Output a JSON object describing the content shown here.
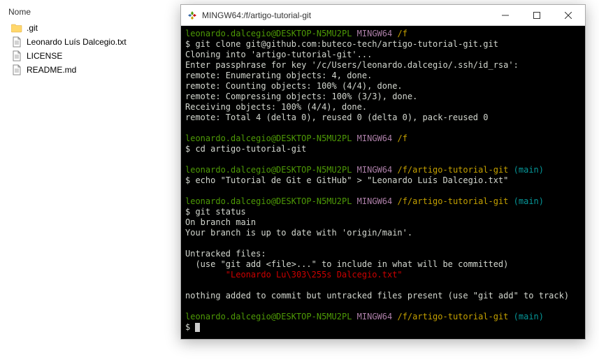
{
  "explorer": {
    "header": "Nome",
    "items": [
      {
        "name": ".git",
        "type": "folder"
      },
      {
        "name": "Leonardo Luís Dalcegio.txt",
        "type": "file"
      },
      {
        "name": "LICENSE",
        "type": "file"
      },
      {
        "name": "README.md",
        "type": "file"
      }
    ]
  },
  "terminal": {
    "title": "MINGW64:/f/artigo-tutorial-git",
    "prompts": [
      {
        "user": "leonardo.dalcegio@DESKTOP-N5MU2PL",
        "env": "MINGW64",
        "path": "/f",
        "branch": ""
      },
      {
        "user": "leonardo.dalcegio@DESKTOP-N5MU2PL",
        "env": "MINGW64",
        "path": "/f",
        "branch": ""
      },
      {
        "user": "leonardo.dalcegio@DESKTOP-N5MU2PL",
        "env": "MINGW64",
        "path": "/f/artigo-tutorial-git",
        "branch": "(main)"
      },
      {
        "user": "leonardo.dalcegio@DESKTOP-N5MU2PL",
        "env": "MINGW64",
        "path": "/f/artigo-tutorial-git",
        "branch": "(main)"
      },
      {
        "user": "leonardo.dalcegio@DESKTOP-N5MU2PL",
        "env": "MINGW64",
        "path": "/f/artigo-tutorial-git",
        "branch": "(main)"
      }
    ],
    "cmd1": "$ git clone git@github.com:buteco-tech/artigo-tutorial-git.git",
    "out1a": "Cloning into 'artigo-tutorial-git'...",
    "out1b": "Enter passphrase for key '/c/Users/leonardo.dalcegio/.ssh/id_rsa':",
    "out1c": "remote: Enumerating objects: 4, done.",
    "out1d": "remote: Counting objects: 100% (4/4), done.",
    "out1e": "remote: Compressing objects: 100% (3/3), done.",
    "out1f": "Receiving objects: 100% (4/4), done.",
    "out1g": "remote: Total 4 (delta 0), reused 0 (delta 0), pack-reused 0",
    "cmd2": "$ cd artigo-tutorial-git",
    "cmd3": "$ echo \"Tutorial de Git e GitHub\" > \"Leonardo Luís Dalcegio.txt\"",
    "cmd4": "$ git status",
    "out4a": "On branch main",
    "out4b": "Your branch is up to date with 'origin/main'.",
    "out4c": "Untracked files:",
    "out4d": "  (use \"git add <file>...\" to include in what will be committed)",
    "out4e": "        ",
    "out4e_red": "\"Leonardo Lu\\303\\255s Dalcegio.txt\"",
    "out4f": "nothing added to commit but untracked files present (use \"git add\" to track)",
    "cmd5": "$ "
  }
}
